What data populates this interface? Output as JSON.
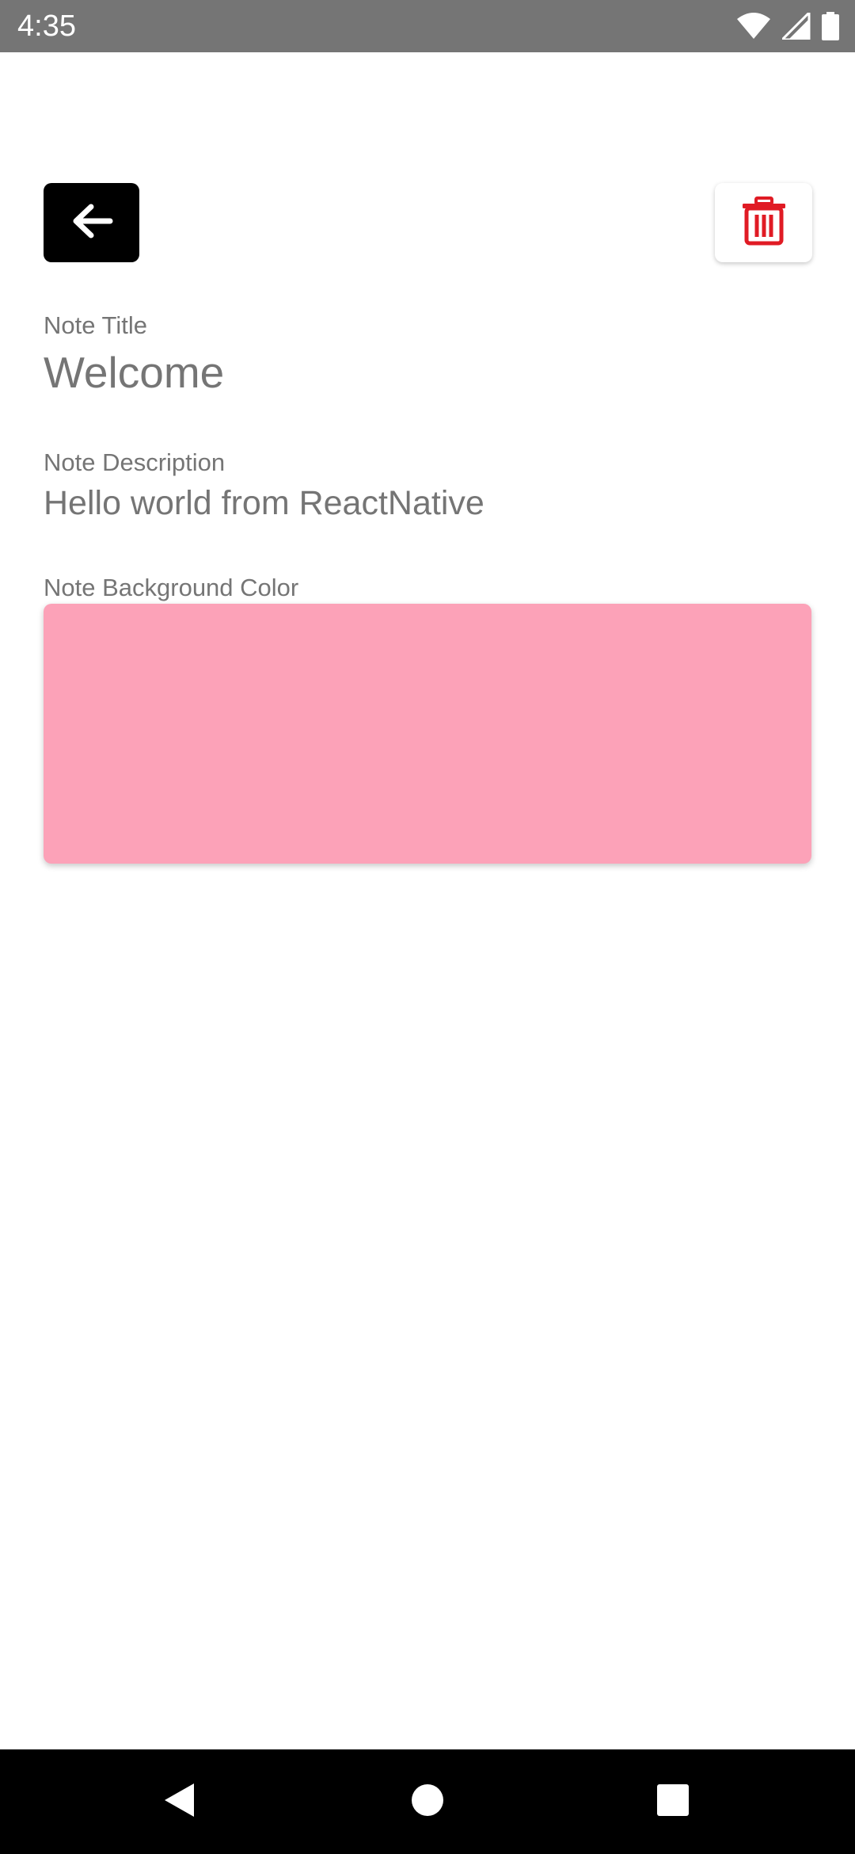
{
  "status_bar": {
    "time": "4:35",
    "icons": [
      "wifi-icon",
      "cellular-signal-icon",
      "battery-icon"
    ],
    "background_color": "#757575"
  },
  "toolbar": {
    "back_icon": "arrow-left-icon",
    "delete_icon": "trash-icon",
    "back_button_color": "#000000",
    "delete_icon_color": "#e01b24"
  },
  "note": {
    "title_label": "Note Title",
    "title_value": "Welcome",
    "description_label": "Note Description",
    "description_value": "Hello world from ReactNative",
    "background_color_label": "Note Background Color",
    "background_color": "#fca2b8"
  },
  "nav_bar": {
    "icons": [
      "nav-back-icon",
      "nav-home-icon",
      "nav-recents-icon"
    ]
  }
}
